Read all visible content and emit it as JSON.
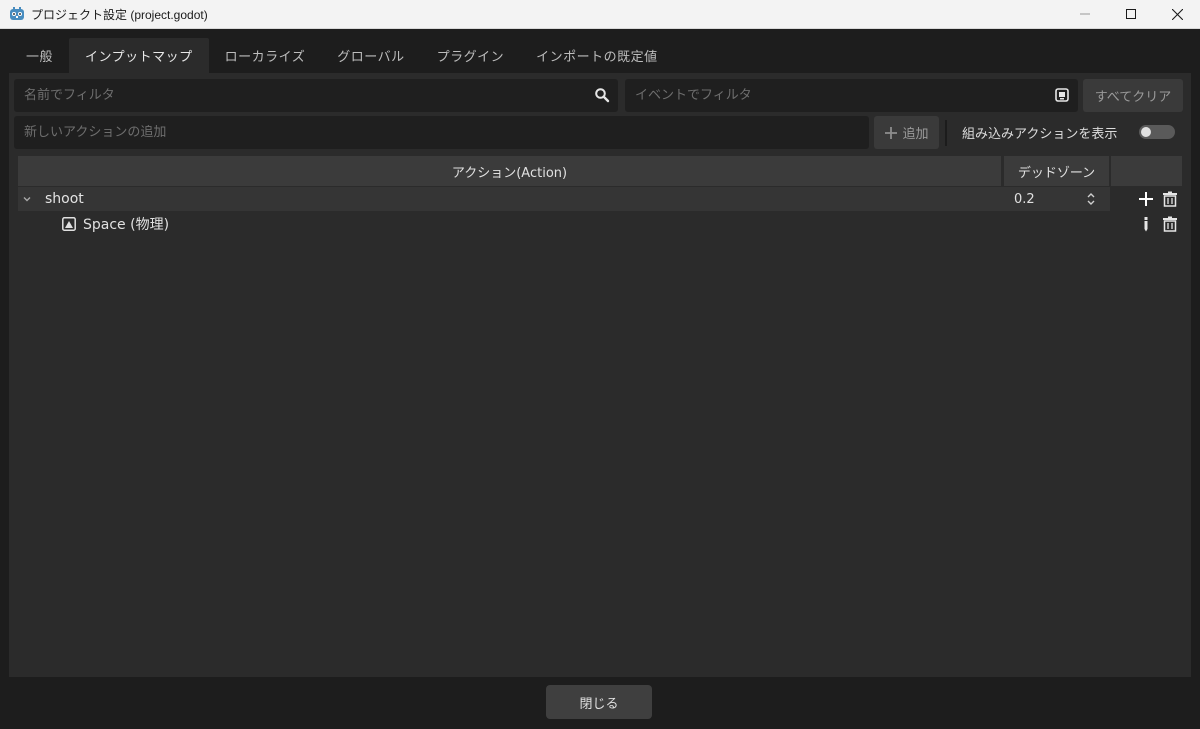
{
  "window": {
    "title": "プロジェクト設定 (project.godot)",
    "accent": "#478cbf"
  },
  "tabs": [
    {
      "label": "一般",
      "active": false
    },
    {
      "label": "インプットマップ",
      "active": true
    },
    {
      "label": "ローカライズ",
      "active": false
    },
    {
      "label": "グローバル",
      "active": false
    },
    {
      "label": "プラグイン",
      "active": false
    },
    {
      "label": "インポートの既定値",
      "active": false
    }
  ],
  "filters": {
    "name_placeholder": "名前でフィルタ",
    "event_placeholder": "イベントでフィルタ",
    "clear_all_label": "すべてクリア"
  },
  "add_action": {
    "placeholder": "新しいアクションの追加",
    "add_label": "追加",
    "show_builtin_label": "組み込みアクションを表示",
    "show_builtin_on": false
  },
  "table": {
    "col_action": "アクション(Action)",
    "col_deadzone": "デッドゾーン",
    "actions": [
      {
        "name": "shoot",
        "deadzone": "0.2",
        "events": [
          {
            "label": "Space (物理)"
          }
        ]
      }
    ]
  },
  "footer": {
    "close_label": "閉じる"
  }
}
